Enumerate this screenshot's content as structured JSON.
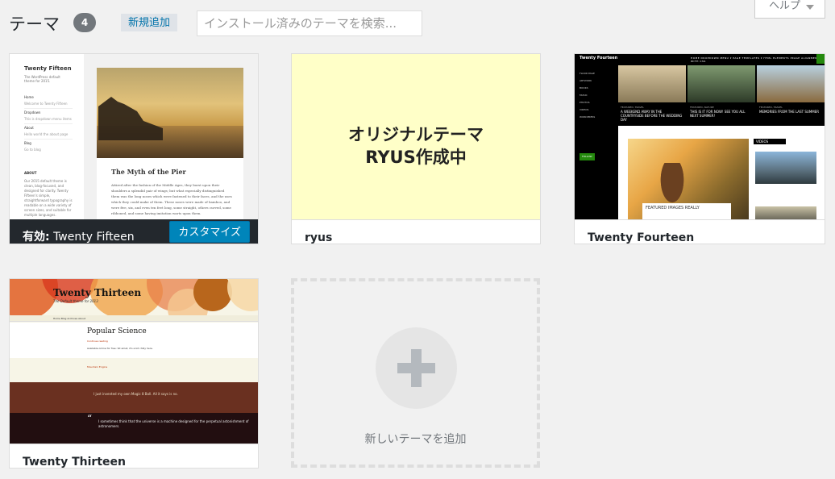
{
  "header": {
    "title": "テーマ",
    "count": "4",
    "add_new": "新規追加",
    "search_placeholder": "インストール済みのテーマを検索...",
    "help": "ヘルプ"
  },
  "themes": [
    {
      "name": "Twenty Fifteen",
      "active": true,
      "active_label": "有効:",
      "customize_label": "カスタマイズ",
      "preview": {
        "site_title": "Twenty Fifteen",
        "tagline": "The WordPress default theme for 2015.",
        "nav": [
          "Home",
          "Welcome to Twenty Fifteen",
          "Dropdown",
          "This is dropdown menu items",
          "About",
          "Hello world the about page",
          "Blog",
          "Go to blog"
        ],
        "about_heading": "ABOUT",
        "about_text": "Our 2015 default theme is clean, blog-focused, and designed for clarity. Twenty Fifteen's simple, straightforward typography is readable on a wide variety of screen sizes, and suitable for multiple languages.",
        "post_title": "The Myth of the Pier",
        "post_text": "Attired after the fashion of the Middle Ages, they burst upon their shoulders a splendid pair of wings; but what especially distinguished them was the long noses which were fastened to their faces, and the uses which they could make of them. These noses were made of bamboo, and were five, six, and even ten feet long, some straight, others curved, some ribboned, and some having imitation warts upon them."
      }
    },
    {
      "name": "ryus",
      "active": false,
      "preview": {
        "line1": "オリジナルテーマ",
        "line2": "RYUS作成中"
      }
    },
    {
      "name": "Twenty Fourteen",
      "active": false,
      "preview": {
        "site_title": "Twenty Fourteen",
        "menu": "HOME   DROPDOWN MENU ▾   PAGE TEMPLATES ▾   HTML ELEMENTS   IMAGE ALIGNMENT WITH CSS",
        "side_items": [
          "FLOOR PAGE",
          "ARTWORK",
          "BOOKS",
          "MUSIC",
          "PHOTOS",
          "VIDEOS",
          "WORDPRESS"
        ],
        "follow": "FOLLOW",
        "tiles": [
          {
            "cat": "FEATURED, TRAVEL",
            "title": "A WEEKEND AWAY IN THE COUNTRYSIDE BEFORE THE WEDDING DAY",
            "colors": [
              "#d8c7a2",
              "#8a7a58"
            ]
          },
          {
            "cat": "FEATURED, NATURE",
            "title": "THIS IS IT FOR NOW! SEE YOU ALL NEXT SUMMER!",
            "colors": [
              "#7f9a70",
              "#2d3a28"
            ]
          },
          {
            "cat": "FEATURED, TRAVEL",
            "title": "MEMORIES FROM THE LAST SUMMER",
            "colors": [
              "#b8d0e0",
              "#8a6a3e"
            ]
          }
        ],
        "featured_caption": "FEATURED IMAGES REALLY",
        "videos_label": "VIDEOS"
      }
    },
    {
      "name": "Twenty Thirteen",
      "active": false,
      "preview": {
        "site_title": "Twenty Thirteen",
        "tagline": "The Default theme for 2013",
        "nav": "Home   Blog Archives   About",
        "post_title": "Popular Science",
        "post_meta": "Continue reading",
        "post_text": "Available online for free: Sit amet, it's a bit chilly here.",
        "link_post": "Mountain Engine",
        "quote_post": "I just invented my own Magic 8 Ball. All it says is no.",
        "quote": "I sometimes think that the universe is a machine designed for the perpetual astonishment of astronomers."
      }
    }
  ],
  "add_new_theme": {
    "label": "新しいテーマを追加"
  }
}
